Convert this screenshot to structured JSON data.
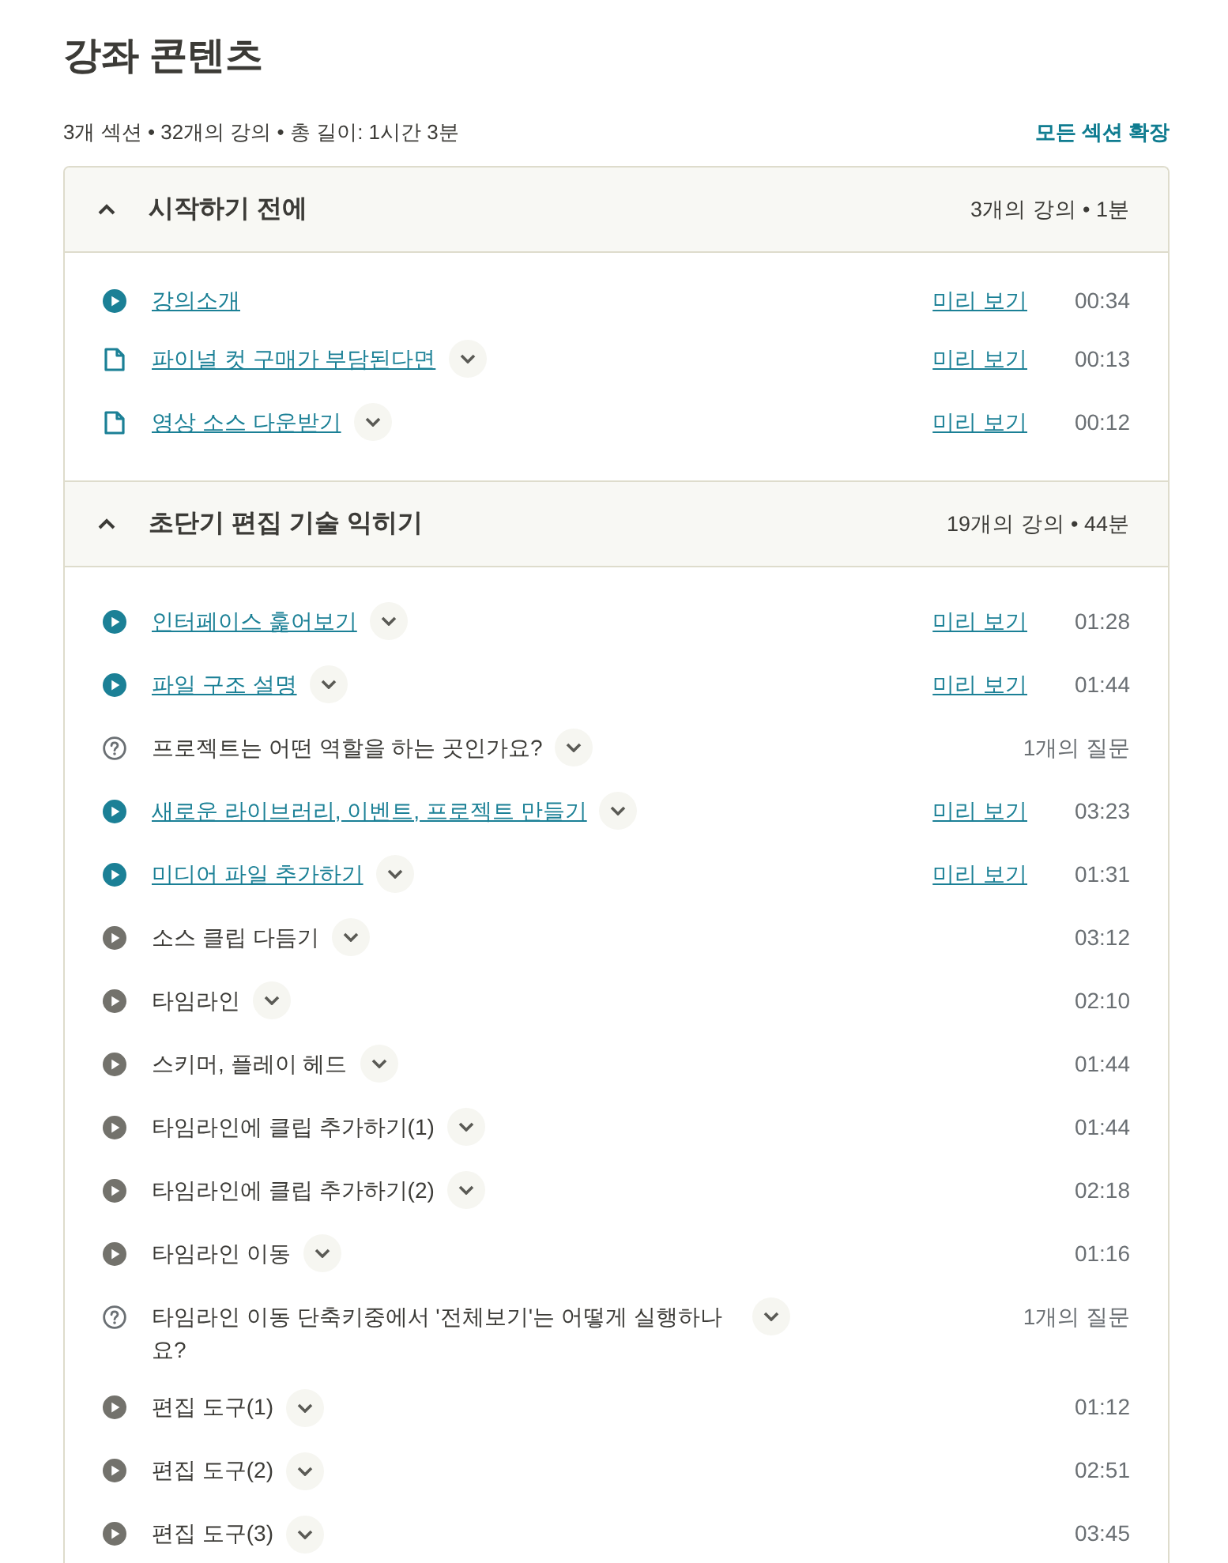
{
  "title": "강좌 콘텐츠",
  "summary": "3개 섹션 • 32개의 강의 • 총 길이: 1시간 3분",
  "expand_all": "모든 섹션 확장",
  "sections": [
    {
      "title": "시작하기 전에",
      "meta": "3개의 강의 • 1분",
      "expanded": true,
      "items": [
        {
          "kind": "video",
          "title": "강의소개",
          "expandable": false,
          "preview": "미리 보기",
          "duration": "00:34"
        },
        {
          "kind": "article",
          "title": "파이널 컷 구매가 부담된다면",
          "expandable": true,
          "preview": "미리 보기",
          "duration": "00:13"
        },
        {
          "kind": "article",
          "title": "영상 소스 다운받기",
          "expandable": true,
          "preview": "미리 보기",
          "duration": "00:12"
        }
      ]
    },
    {
      "title": "초단기 편집 기술 익히기",
      "meta": "19개의 강의 • 44분",
      "expanded": true,
      "items": [
        {
          "kind": "video",
          "title": "인터페이스 훑어보기",
          "expandable": true,
          "preview": "미리 보기",
          "duration": "01:28"
        },
        {
          "kind": "video",
          "title": "파일 구조 설명",
          "expandable": true,
          "preview": "미리 보기",
          "duration": "01:44"
        },
        {
          "kind": "quiz",
          "title": "프로젝트는 어떤 역할을 하는 곳인가요?",
          "expandable": true,
          "question_count": "1개의 질문"
        },
        {
          "kind": "video",
          "title": "새로운 라이브러리, 이벤트, 프로젝트 만들기",
          "expandable": true,
          "preview": "미리 보기",
          "duration": "03:23"
        },
        {
          "kind": "video",
          "title": "미디어 파일 추가하기",
          "expandable": true,
          "preview": "미리 보기",
          "duration": "01:31"
        },
        {
          "kind": "video",
          "title": "소스 클립 다듬기",
          "expandable": true,
          "duration": "03:12"
        },
        {
          "kind": "video",
          "title": "타임라인",
          "expandable": true,
          "duration": "02:10"
        },
        {
          "kind": "video",
          "title": "스키머, 플레이 헤드",
          "expandable": true,
          "duration": "01:44"
        },
        {
          "kind": "video",
          "title": "타임라인에 클립 추가하기(1)",
          "expandable": true,
          "duration": "01:44"
        },
        {
          "kind": "video",
          "title": "타임라인에 클립 추가하기(2)",
          "expandable": true,
          "duration": "02:18"
        },
        {
          "kind": "video",
          "title": "타임라인 이동",
          "expandable": true,
          "duration": "01:16"
        },
        {
          "kind": "quiz",
          "title": "타임라인 이동 단축키중에서 '전체보기'는 어떻게 실행하나요?",
          "expandable": true,
          "question_count": "1개의 질문"
        },
        {
          "kind": "video",
          "title": "편집 도구(1)",
          "expandable": true,
          "duration": "01:12"
        },
        {
          "kind": "video",
          "title": "편집 도구(2)",
          "expandable": true,
          "duration": "02:51"
        },
        {
          "kind": "video",
          "title": "편집 도구(3)",
          "expandable": true,
          "duration": "03:45"
        }
      ]
    }
  ]
}
